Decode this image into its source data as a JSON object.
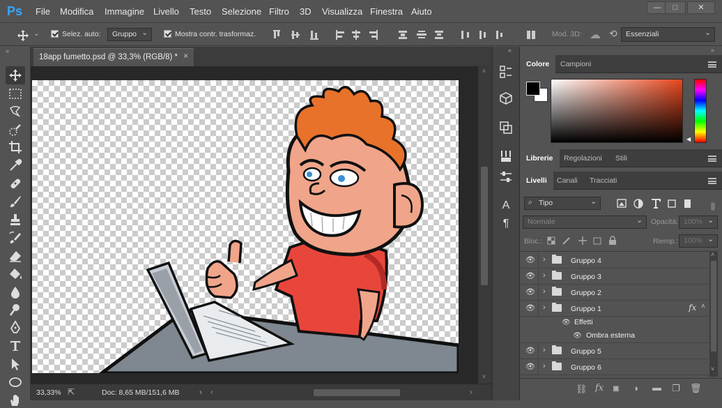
{
  "app": {
    "logo": "Ps"
  },
  "menu": [
    "File",
    "Modifica",
    "Immagine",
    "Livello",
    "Testo",
    "Selezione",
    "Filtro",
    "3D",
    "Visualizza",
    "Finestra",
    "Aiuto"
  ],
  "window_controls": {
    "minimize": "—",
    "restore": "□",
    "close": "✕"
  },
  "options": {
    "auto_select_label": "Selez. auto:",
    "auto_select_value": "Gruppo",
    "transform_label": "Mostra contr. trasformaz.",
    "mode3d_label": "Mod. 3D:",
    "workspace": "Essenziali"
  },
  "document": {
    "tab_title": "18app fumetto.psd @ 33,3% (RGB/8) *",
    "close": "×"
  },
  "status": {
    "zoom": "33,33%",
    "doc_info": "Doc: 8,65 MB/151,6 MB"
  },
  "color_panel": {
    "tabs": [
      "Colore",
      "Campioni"
    ],
    "foreground": "#000000",
    "background": "#ffffff",
    "picker_hue": "#e8461c"
  },
  "lib_panel": {
    "tabs": [
      "Librerie",
      "Regolazioni",
      "Stili"
    ]
  },
  "layers_panel": {
    "tabs": [
      "Livelli",
      "Canali",
      "Tracciati"
    ],
    "filter_kind": "Tipo",
    "blend_mode": "Normale",
    "opacity_label": "Opacità:",
    "opacity_value": "100%",
    "lock_label": "Bloc.:",
    "fill_label": "Riemp.:",
    "fill_value": "100%",
    "layers": [
      {
        "name": "Gruppo 4"
      },
      {
        "name": "Gruppo 3"
      },
      {
        "name": "Gruppo 2"
      },
      {
        "name": "Gruppo 1",
        "fx": "fx"
      },
      {
        "name": "Gruppo 5"
      },
      {
        "name": "Gruppo 6"
      }
    ],
    "effects_label": "Effetti",
    "effect_item": "Ombra esterna"
  },
  "colors": {
    "accent": "#31a8ff",
    "shirt": "#e8463b",
    "hair": "#e8722a",
    "skin": "#f0a58a",
    "desk": "#7f8790"
  }
}
